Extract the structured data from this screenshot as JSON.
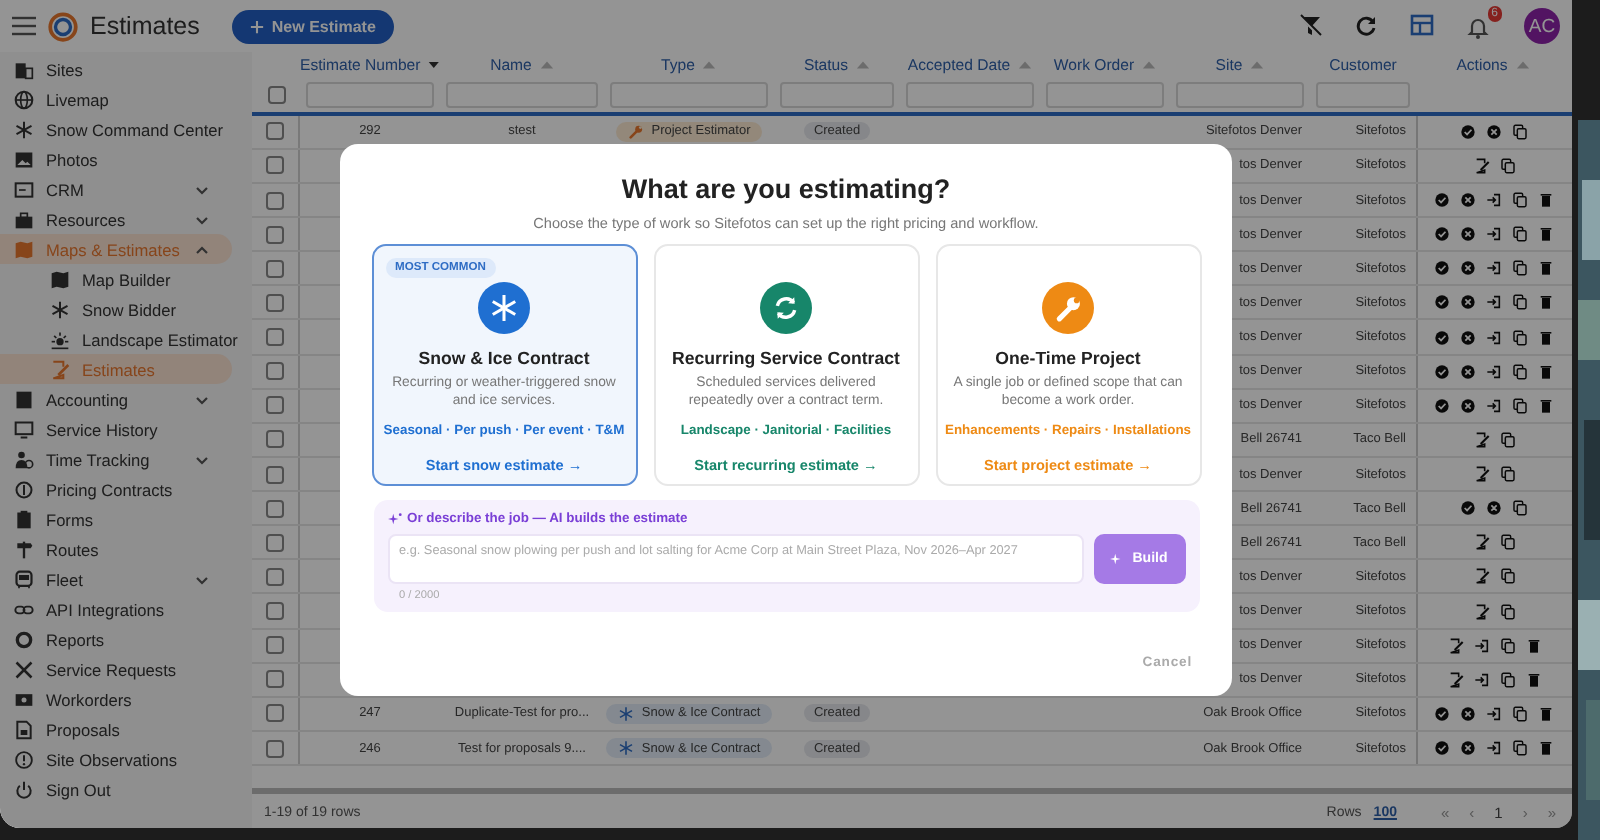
{
  "top_bar": {
    "title": "Estimates",
    "new_button": "New Estimate",
    "notifications": {
      "badge": "6"
    },
    "avatar": "AC"
  },
  "sidebar": {
    "items": [
      {
        "label": "Sites",
        "selected": false
      },
      {
        "label": "Livemap",
        "selected": false
      },
      {
        "label": "Snow Command Center",
        "selected": false
      },
      {
        "label": "Photos",
        "selected": false
      },
      {
        "label": "CRM",
        "selected": false,
        "expanded": false
      },
      {
        "label": "Resources",
        "selected": false,
        "expanded": false
      },
      {
        "label": "Maps & Estimates",
        "selected": true,
        "expanded": true,
        "children": [
          {
            "label": "Map Builder",
            "selected": false
          },
          {
            "label": "Snow Bidder",
            "selected": false
          },
          {
            "label": "Landscape Estimator",
            "selected": false
          },
          {
            "label": "Estimates",
            "selected": true
          }
        ]
      },
      {
        "label": "Accounting",
        "selected": false,
        "expanded": false
      },
      {
        "label": "Service History",
        "selected": false
      },
      {
        "label": "Time Tracking",
        "selected": false,
        "expanded": false
      },
      {
        "label": "Pricing Contracts",
        "selected": false
      },
      {
        "label": "Forms",
        "selected": false
      },
      {
        "label": "Routes",
        "selected": false
      },
      {
        "label": "Fleet",
        "selected": false,
        "expanded": false
      },
      {
        "label": "API Integrations",
        "selected": false
      },
      {
        "label": "Reports",
        "selected": false
      },
      {
        "label": "Service Requests",
        "selected": false
      },
      {
        "label": "Workorders",
        "selected": false
      },
      {
        "label": "Proposals",
        "selected": false
      },
      {
        "label": "Site Observations",
        "selected": false
      },
      {
        "label": "Sign Out",
        "selected": false
      }
    ]
  },
  "table": {
    "select_all": {
      "checked": false
    },
    "columns": [
      {
        "label": "Estimate Number",
        "sorted": true,
        "filter": true
      },
      {
        "label": "Name",
        "sorted": false,
        "filter": true
      },
      {
        "label": "Type",
        "sorted": false,
        "filter": true
      },
      {
        "label": "Status",
        "sorted": false,
        "filter": true
      },
      {
        "label": "Accepted Date",
        "sorted": false,
        "filter": true
      },
      {
        "label": "Work Order",
        "sorted": false,
        "filter": true
      },
      {
        "label": "Site",
        "sorted": false,
        "filter": true
      },
      {
        "label": "Customer",
        "filter": true
      },
      {
        "label": "Actions",
        "sorted": false,
        "filter": false
      }
    ],
    "rows": [
      {
        "checked": false,
        "number": "292",
        "name": "stest",
        "type": {
          "kind": "project",
          "label": "Project Estimator"
        },
        "status": "Created",
        "site": "Sitefotos Denver",
        "customer": "Sitefotos",
        "actions": [
          {
            "kind": "approve"
          },
          {
            "kind": "reject"
          },
          {
            "kind": "copy"
          }
        ]
      },
      {
        "checked": false,
        "site": "tos Denver",
        "customer": "Sitefotos",
        "actions": [
          {
            "kind": "edit"
          },
          {
            "kind": "copy"
          }
        ]
      },
      {
        "checked": false,
        "site": "tos Denver",
        "customer": "Sitefotos",
        "actions": [
          {
            "kind": "approve"
          },
          {
            "kind": "reject"
          },
          {
            "kind": "convert"
          },
          {
            "kind": "copy"
          },
          {
            "kind": "delete"
          }
        ]
      },
      {
        "checked": false,
        "site": "tos Denver",
        "customer": "Sitefotos",
        "actions": [
          {
            "kind": "approve"
          },
          {
            "kind": "reject"
          },
          {
            "kind": "convert"
          },
          {
            "kind": "copy"
          },
          {
            "kind": "delete"
          }
        ]
      },
      {
        "checked": false,
        "site": "tos Denver",
        "customer": "Sitefotos",
        "actions": [
          {
            "kind": "approve"
          },
          {
            "kind": "reject"
          },
          {
            "kind": "convert"
          },
          {
            "kind": "copy"
          },
          {
            "kind": "delete"
          }
        ]
      },
      {
        "checked": false,
        "site": "tos Denver",
        "customer": "Sitefotos",
        "actions": [
          {
            "kind": "approve"
          },
          {
            "kind": "reject"
          },
          {
            "kind": "convert"
          },
          {
            "kind": "copy"
          },
          {
            "kind": "delete"
          }
        ]
      },
      {
        "checked": false,
        "site": "tos Denver",
        "customer": "Sitefotos",
        "actions": [
          {
            "kind": "approve"
          },
          {
            "kind": "reject"
          },
          {
            "kind": "convert"
          },
          {
            "kind": "copy"
          },
          {
            "kind": "delete"
          }
        ]
      },
      {
        "checked": false,
        "site": "tos Denver",
        "customer": "Sitefotos",
        "actions": [
          {
            "kind": "approve"
          },
          {
            "kind": "reject"
          },
          {
            "kind": "convert"
          },
          {
            "kind": "copy"
          },
          {
            "kind": "delete"
          }
        ]
      },
      {
        "checked": false,
        "site": "tos Denver",
        "customer": "Sitefotos",
        "actions": [
          {
            "kind": "approve"
          },
          {
            "kind": "reject"
          },
          {
            "kind": "convert"
          },
          {
            "kind": "copy"
          },
          {
            "kind": "delete"
          }
        ]
      },
      {
        "checked": false,
        "site": "Bell 26741",
        "customer": "Taco Bell",
        "actions": [
          {
            "kind": "edit"
          },
          {
            "kind": "copy"
          }
        ]
      },
      {
        "checked": false,
        "site": "tos Denver",
        "customer": "Sitefotos",
        "actions": [
          {
            "kind": "edit"
          },
          {
            "kind": "copy"
          }
        ]
      },
      {
        "checked": false,
        "site": "Bell 26741",
        "customer": "Taco Bell",
        "actions": [
          {
            "kind": "approve"
          },
          {
            "kind": "reject"
          },
          {
            "kind": "copy"
          }
        ]
      },
      {
        "checked": false,
        "site": "Bell 26741",
        "customer": "Taco Bell",
        "actions": [
          {
            "kind": "edit"
          },
          {
            "kind": "copy"
          }
        ]
      },
      {
        "checked": false,
        "site": "tos Denver",
        "customer": "Sitefotos",
        "actions": [
          {
            "kind": "edit"
          },
          {
            "kind": "copy"
          }
        ]
      },
      {
        "checked": false,
        "site": "tos Denver",
        "customer": "Sitefotos",
        "actions": [
          {
            "kind": "edit"
          },
          {
            "kind": "copy"
          }
        ]
      },
      {
        "checked": false,
        "site": "tos Denver",
        "customer": "Sitefotos",
        "actions": [
          {
            "kind": "edit"
          },
          {
            "kind": "convert"
          },
          {
            "kind": "copy"
          },
          {
            "kind": "delete"
          }
        ]
      },
      {
        "checked": false,
        "site": "tos Denver",
        "customer": "Sitefotos",
        "actions": [
          {
            "kind": "edit"
          },
          {
            "kind": "convert"
          },
          {
            "kind": "copy"
          },
          {
            "kind": "delete"
          }
        ]
      },
      {
        "checked": false,
        "number": "247",
        "name": "Duplicate-Test for pro...",
        "type": {
          "kind": "snow",
          "label": "Snow & Ice Contract"
        },
        "status": "Created",
        "site": "Oak Brook Office",
        "customer": "Sitefotos",
        "actions": [
          {
            "kind": "approve"
          },
          {
            "kind": "reject"
          },
          {
            "kind": "convert"
          },
          {
            "kind": "copy"
          },
          {
            "kind": "delete"
          }
        ]
      },
      {
        "checked": false,
        "number": "246",
        "name": "Test for proposals 9....",
        "type": {
          "kind": "snow",
          "label": "Snow & Ice Contract"
        },
        "status": "Created",
        "site": "Oak Brook Office",
        "customer": "Sitefotos",
        "actions": [
          {
            "kind": "approve"
          },
          {
            "kind": "reject"
          },
          {
            "kind": "convert"
          },
          {
            "kind": "copy"
          },
          {
            "kind": "delete"
          }
        ]
      }
    ],
    "footer": {
      "range": "1-19 of 19 rows",
      "rows_label": "Rows",
      "rows_per_page": "100",
      "prev": [
        "«",
        "‹"
      ],
      "page": "1",
      "next": [
        "›",
        "»"
      ]
    }
  },
  "modal": {
    "title": "What are you estimating?",
    "subtitle": "Choose the type of work so Sitefotos can set up the right pricing and workflow.",
    "cards": [
      {
        "kind": "snow",
        "badge": "MOST COMMON",
        "title": "Snow & Ice Contract",
        "description": "Recurring or weather-triggered snow and ice services.",
        "tags": "Seasonal · Per push · Per event · T&M",
        "link": "Start snow estimate →",
        "color": "#1f6fd1",
        "selected": true
      },
      {
        "kind": "recurring",
        "title": "Recurring Service Contract",
        "description": "Scheduled services delivered repeatedly over a contract term.",
        "tags": "Landscape · Janitorial · Facilities",
        "link": "Start recurring estimate →",
        "color": "#17866a",
        "selected": false
      },
      {
        "kind": "project",
        "title": "One-Time Project",
        "description": "A single job or defined scope that can become a work order.",
        "tags": "Enhancements · Repairs · Installations",
        "link": "Start project estimate →",
        "color": "#ee8a14",
        "selected": false
      }
    ],
    "ai": {
      "label": "Or describe the job — AI builds the estimate",
      "placeholder": "e.g. Seasonal snow plowing per push and lot salting for Acme Corp at Main Street Plaza, Nov 2026–Apr 2027",
      "counter": "0 / 2000",
      "button": {
        "label": "Build",
        "disabled": true
      }
    },
    "cancel": "Cancel"
  }
}
